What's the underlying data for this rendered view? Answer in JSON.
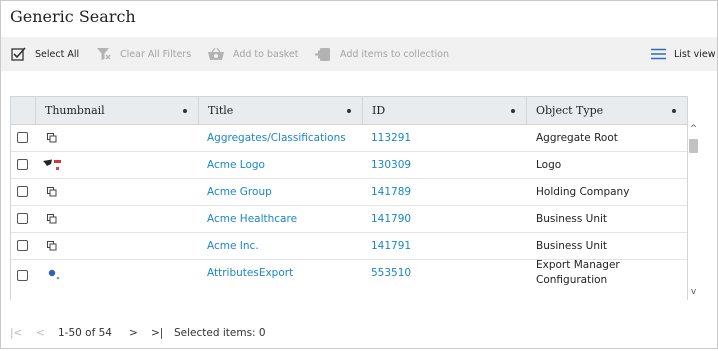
{
  "page": {
    "title": "Generic Search"
  },
  "toolbar": {
    "select_all": "Select All",
    "clear_filters": "Clear All Filters",
    "add_basket": "Add to basket",
    "add_collection": "Add items to collection",
    "list_view": "List view"
  },
  "grid": {
    "headers": {
      "thumbnail": "Thumbnail",
      "title": "Title",
      "id": "ID",
      "object_type": "Object Type"
    },
    "rows": [
      {
        "title": "Aggregates/Classifications",
        "id": "113291",
        "type": "Aggregate Root",
        "thumb_icon": "copy-icon"
      },
      {
        "title": "Acme Logo",
        "id": "130309",
        "type": "Logo",
        "thumb_icon": "logo-image-icon"
      },
      {
        "title": "Acme Group",
        "id": "141789",
        "type": "Holding Company",
        "thumb_icon": "copy-icon"
      },
      {
        "title": "Acme Healthcare",
        "id": "141790",
        "type": "Business Unit",
        "thumb_icon": "copy-icon"
      },
      {
        "title": "Acme Inc.",
        "id": "141791",
        "type": "Business Unit",
        "thumb_icon": "copy-icon"
      },
      {
        "title": "AttributesExport",
        "id": "553510",
        "type_line1": "Export Manager",
        "type_line2": "Configuration",
        "thumb_icon": "export-config-icon"
      }
    ]
  },
  "pager": {
    "first": "|<",
    "prev": "<",
    "range": "1-50 of 54",
    "next": ">",
    "last": ">|",
    "selected_label": "Selected items: 0"
  },
  "colors": {
    "link": "#1a86c8",
    "toolbar_bg": "#f1f1f1",
    "header_bg": "#e9ecef",
    "disabled": "#a3a3a3",
    "accent": "#2f6fb3"
  }
}
